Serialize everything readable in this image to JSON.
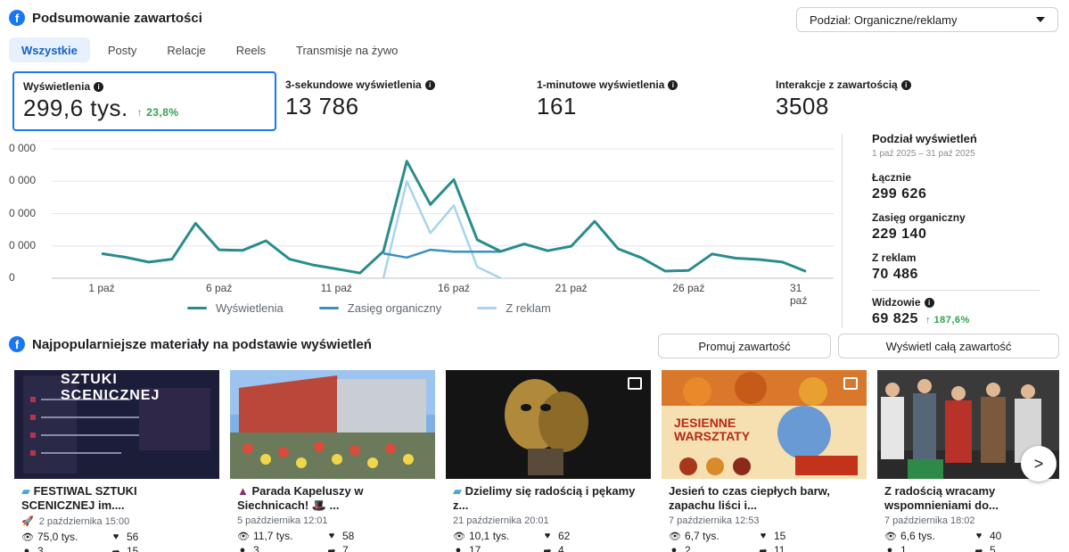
{
  "header": {
    "title": "Podsumowanie zawartości",
    "split_select": "Podział: Organiczne/reklamy"
  },
  "tabs": [
    {
      "label": "Wszystkie"
    },
    {
      "label": "Posty"
    },
    {
      "label": "Relacje"
    },
    {
      "label": "Reels"
    },
    {
      "label": "Transmisje na żywo"
    }
  ],
  "kpis": [
    {
      "label": "Wyświetlenia",
      "value": "299,6 tys.",
      "change": "↑ 23,8%"
    },
    {
      "label": "3-sekundowe wyświetlenia",
      "value": "13 786"
    },
    {
      "label": "1-minutowe wyświetlenia",
      "value": "161"
    },
    {
      "label": "Interakcje z zawartością",
      "value": "3508"
    }
  ],
  "chart_data": {
    "type": "line",
    "x": [
      "1 paź",
      "2 paź",
      "3 paź",
      "4 paź",
      "5 paź",
      "6 paź",
      "7 paź",
      "8 paź",
      "9 paź",
      "10 paź",
      "11 paź",
      "12 paź",
      "13 paź",
      "14 paź",
      "15 paź",
      "16 paź",
      "17 paź",
      "18 paź",
      "19 paź",
      "20 paź",
      "21 paź",
      "22 paź",
      "23 paź",
      "24 paź",
      "25 paź",
      "26 paź",
      "27 paź",
      "28 paź",
      "29 paź",
      "30 paź",
      "31 paź"
    ],
    "x_tick_labels": [
      "1 paź",
      "6 paź",
      "11 paź",
      "16 paź",
      "21 paź",
      "26 paź",
      "31 paź"
    ],
    "y_tick_labels": [
      "0",
      "0 000",
      "0 000",
      "0 000",
      "0 000"
    ],
    "series": [
      {
        "name": "Wyświetlenia",
        "color": "#2a8c8c",
        "values": [
          7600,
          6500,
          5000,
          5900,
          17000,
          8800,
          8600,
          11600,
          5900,
          4100,
          2900,
          1600,
          8300,
          36200,
          22800,
          30500,
          11900,
          8300,
          10600,
          8500,
          9900,
          17600,
          9100,
          6300,
          2200,
          2400,
          7500,
          6200,
          5800,
          5000,
          2100
        ]
      },
      {
        "name": "Zasięg organiczny",
        "color": "#3b8fc4",
        "values": [
          null,
          null,
          null,
          null,
          null,
          null,
          null,
          null,
          null,
          null,
          null,
          null,
          7700,
          6400,
          8800,
          8200,
          8200,
          8200,
          null,
          null,
          null,
          null,
          null,
          null,
          null,
          null,
          null,
          null,
          null,
          null,
          null
        ]
      },
      {
        "name": "Z reklam",
        "color": "#a8d4ee",
        "values": [
          null,
          null,
          null,
          null,
          null,
          null,
          null,
          null,
          null,
          null,
          null,
          null,
          0,
          30000,
          14000,
          22500,
          3500,
          0,
          null,
          null,
          null,
          null,
          null,
          null,
          null,
          null,
          null,
          null,
          null,
          null,
          null
        ]
      }
    ],
    "ylim": [
      0,
      40000
    ],
    "grid": true,
    "legend": "bottom"
  },
  "breakdown": {
    "title": "Podział wyświetleń",
    "range": "1 paź 2025 – 31 paź 2025",
    "rows": [
      {
        "label": "Łącznie",
        "value": "299 626"
      },
      {
        "label": "Zasięg organiczny",
        "value": "229 140"
      },
      {
        "label": "Z reklam",
        "value": "70 486"
      }
    ],
    "viewers_label": "Widzowie",
    "viewers_value": "69 825",
    "viewers_change": "↑ 187,6%"
  },
  "popular": {
    "title": "Najpopularniejsze materiały na podstawie wyświetleń",
    "promote_button": "Promuj zawartość",
    "view_all_button": "Wyświetl całą zawartość",
    "next_button": ">"
  },
  "cards": [
    {
      "title": "FESTIWAL SZTUKI SCENICZNEJ im....",
      "date": "2 października 15:00",
      "views": "75,0 tys.",
      "likes": "56",
      "comments": "3",
      "shares": "15",
      "thumb_text": "SZTUKI SCENICZNEJ"
    },
    {
      "title": "Parada Kapeluszy w Siechnicach! 🎩 ...",
      "date": "5 października 12:01",
      "views": "11,7 tys.",
      "likes": "58",
      "comments": "3",
      "shares": "7"
    },
    {
      "title": "Dzielimy się radością i pękamy z...",
      "date": "21 października 20:01",
      "views": "10,1 tys.",
      "likes": "62",
      "comments": "17",
      "shares": "4"
    },
    {
      "title": "Jesień to czas ciepłych barw, zapachu liści i...",
      "date": "7 października 12:53",
      "views": "6,7 tys.",
      "likes": "15",
      "comments": "2",
      "shares": "11",
      "thumb_text": "JESIENNE WARSZTATY"
    },
    {
      "title": "Z radością wracamy wspomnieniami do...",
      "date": "7 października 18:02",
      "views": "6,6 tys.",
      "likes": "40",
      "comments": "1",
      "shares": "5"
    }
  ]
}
